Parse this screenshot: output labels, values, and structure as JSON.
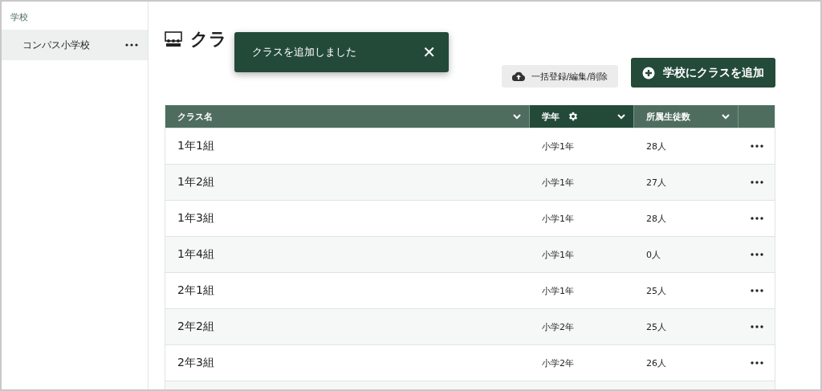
{
  "sidebar": {
    "section_label": "学校",
    "items": [
      {
        "label": "コンパス小学校",
        "selected": true
      }
    ]
  },
  "page": {
    "title": "クラ"
  },
  "toast": {
    "message": "クラスを追加しました",
    "close": "✕"
  },
  "buttons": {
    "bulk": "一括登録/編集/削除",
    "add": "学校にクラスを追加"
  },
  "table": {
    "columns": [
      {
        "label": "クラス名",
        "selected": false,
        "settings": false
      },
      {
        "label": "学年",
        "selected": true,
        "settings": true
      },
      {
        "label": "所属生徒数",
        "selected": false,
        "settings": false
      }
    ],
    "rows": [
      {
        "name": "1年1組",
        "grade": "小学1年",
        "students": "28人"
      },
      {
        "name": "1年2組",
        "grade": "小学1年",
        "students": "27人"
      },
      {
        "name": "1年3組",
        "grade": "小学1年",
        "students": "28人"
      },
      {
        "name": "1年4組",
        "grade": "小学1年",
        "students": "0人"
      },
      {
        "name": "2年1組",
        "grade": "小学1年",
        "students": "25人"
      },
      {
        "name": "2年2組",
        "grade": "小学2年",
        "students": "25人"
      },
      {
        "name": "2年3組",
        "grade": "小学2年",
        "students": "26人"
      }
    ]
  }
}
